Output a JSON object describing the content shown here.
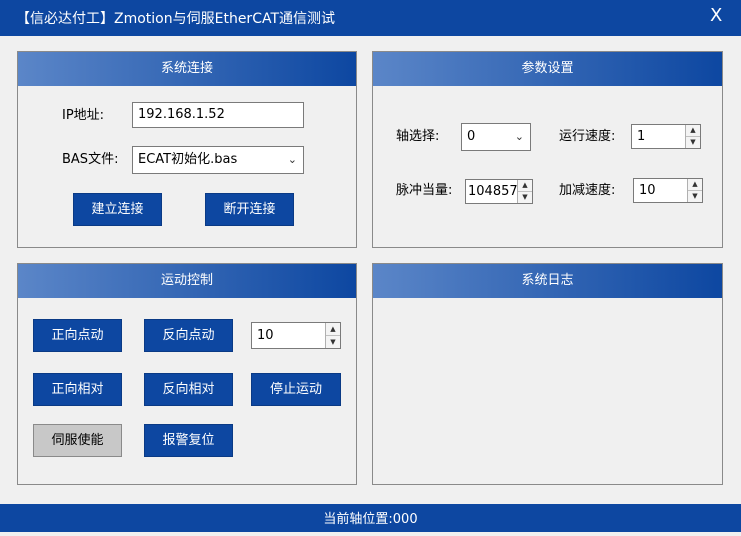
{
  "window": {
    "title": "【信必达付工】Zmotion与伺服EtherCAT通信测试",
    "close_label": "X"
  },
  "connection": {
    "header": "系统连接",
    "ip_label": "IP地址:",
    "ip_value": "192.168.1.52",
    "bas_label": "BAS文件:",
    "bas_value": "ECAT初始化.bas",
    "connect_label": "建立连接",
    "disconnect_label": "断开连接"
  },
  "params": {
    "header": "参数设置",
    "axis_label": "轴选择:",
    "axis_value": "0",
    "speed_label": "运行速度:",
    "speed_value": "1",
    "pulse_label": "脉冲当量:",
    "pulse_value": "104857",
    "accel_label": "加减速度:",
    "accel_value": "10"
  },
  "motion": {
    "header": "运动控制",
    "jog_fwd": "正向点动",
    "jog_rev": "反向点动",
    "step_value": "10",
    "rel_fwd": "正向相对",
    "rel_rev": "反向相对",
    "stop": "停止运动",
    "servo_enable": "伺服使能",
    "alarm_reset": "报警复位"
  },
  "log": {
    "header": "系统日志"
  },
  "status": {
    "position_text": "当前轴位置:000"
  },
  "colors": {
    "primary": "#0D47A1",
    "background": "#F0F0F0",
    "disabled_button": "#C8C8C8"
  }
}
